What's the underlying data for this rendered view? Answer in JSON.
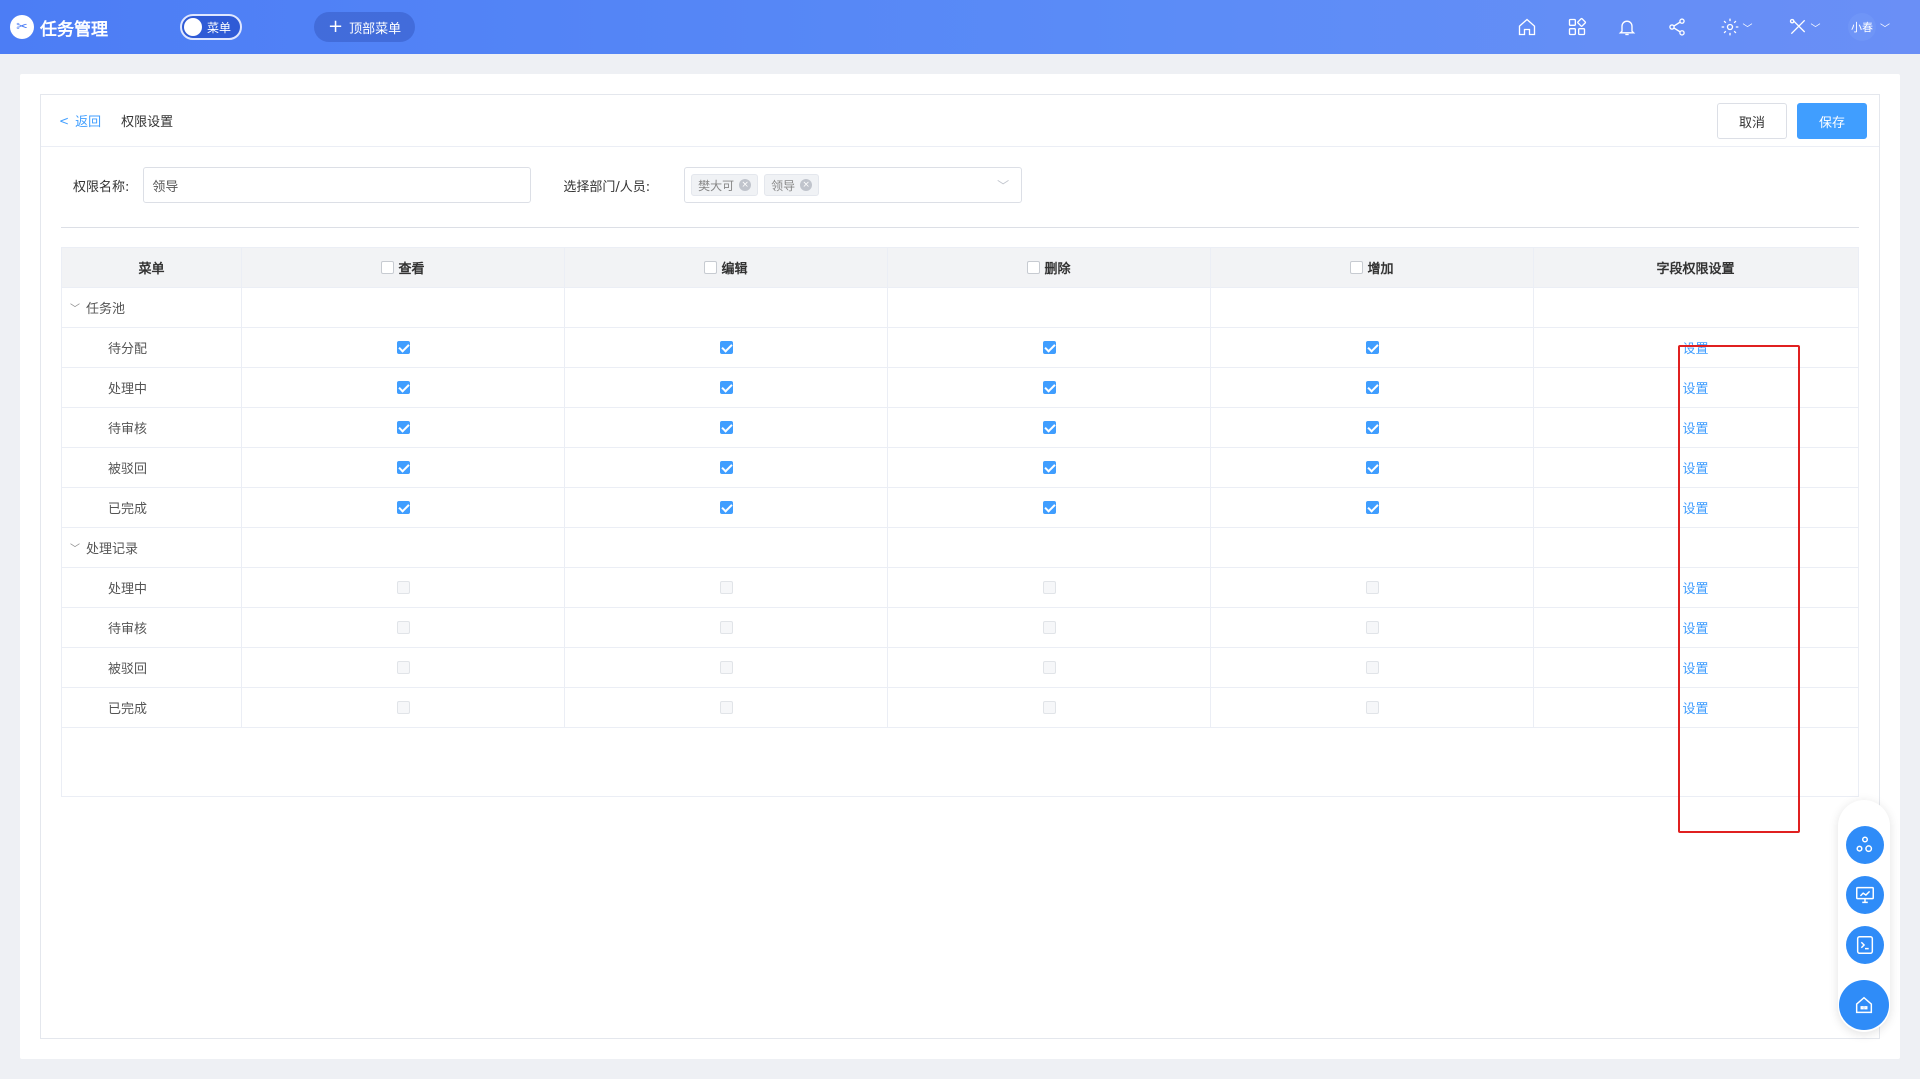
{
  "app": {
    "title": "任务管理",
    "menu_toggle": "菜单",
    "top_menu": "顶部菜单",
    "user": "小春"
  },
  "topbar_icons": [
    "home-icon",
    "grid-icon",
    "bell-icon",
    "share-icon",
    "gear-icon",
    "tools-icon"
  ],
  "header": {
    "back": "返回",
    "breadcrumb": "权限设置",
    "cancel": "取消",
    "save": "保存"
  },
  "form": {
    "name_label": "权限名称:",
    "name_value": "领导",
    "dept_label": "选择部门/人员:",
    "tags": [
      "樊大可",
      "领导"
    ]
  },
  "table": {
    "columns": [
      "菜单",
      "查看",
      "编辑",
      "删除",
      "增加",
      "字段权限设置"
    ],
    "groups": [
      {
        "name": "任务池",
        "rows": [
          {
            "name": "待分配",
            "checked": [
              true,
              true,
              true,
              true
            ],
            "action": "设置"
          },
          {
            "name": "处理中",
            "checked": [
              true,
              true,
              true,
              true
            ],
            "action": "设置"
          },
          {
            "name": "待审核",
            "checked": [
              true,
              true,
              true,
              true
            ],
            "action": "设置"
          },
          {
            "name": "被驳回",
            "checked": [
              true,
              true,
              true,
              true
            ],
            "action": "设置"
          },
          {
            "name": "已完成",
            "checked": [
              true,
              true,
              true,
              true
            ],
            "action": "设置"
          }
        ]
      },
      {
        "name": "处理记录",
        "rows": [
          {
            "name": "处理中",
            "checked": [
              false,
              false,
              false,
              false
            ],
            "action": "设置"
          },
          {
            "name": "待审核",
            "checked": [
              false,
              false,
              false,
              false
            ],
            "action": "设置"
          },
          {
            "name": "被驳回",
            "checked": [
              false,
              false,
              false,
              false
            ],
            "action": "设置"
          },
          {
            "name": "已完成",
            "checked": [
              false,
              false,
              false,
              false
            ],
            "action": "设置"
          }
        ]
      }
    ]
  },
  "colors": {
    "primary": "#409eff",
    "topbar": "#5b8cf7",
    "highlight": "#e02020"
  }
}
